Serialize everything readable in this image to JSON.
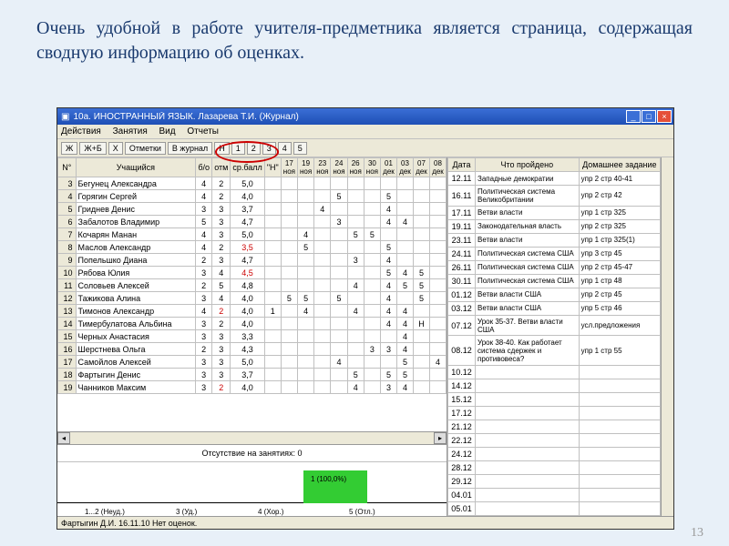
{
  "slide_title": "Очень удобной в работе учителя-предметника является страница, содержащая сводную информацию об оценках.",
  "page_number": "13",
  "window": {
    "title": "10а. ИНОСТРАННЫЙ ЯЗЫК. Лазарева Т.И. (Журнал)",
    "menu": [
      "Действия",
      "Занятия",
      "Вид",
      "Отчеты"
    ],
    "toolbar_buttons": [
      "Ж",
      "Ж+Б",
      "X",
      "Отметки",
      "В журнал",
      "Н",
      "1",
      "2",
      "3",
      "4",
      "5"
    ]
  },
  "grid": {
    "headers": [
      "N°",
      "Учащийся",
      "б/о",
      "отм",
      "ср.балл",
      "\"Н\"",
      "17 ноя",
      "19 ноя",
      "23 ноя",
      "24 ноя",
      "26 ноя",
      "30 ноя",
      "01 дек",
      "03 дек",
      "07 дек",
      "08 дек"
    ],
    "rows": [
      {
        "n": "3",
        "name": "Бегунец Александра",
        "bo": "4",
        "otm": "2",
        "avg": "5,0",
        "h": "",
        "m": [
          "",
          "",
          "",
          "",
          "",
          "",
          "",
          "",
          "",
          ""
        ]
      },
      {
        "n": "4",
        "name": "Горягин Сергей",
        "bo": "4",
        "otm": "2",
        "avg": "4,0",
        "h": "",
        "m": [
          "",
          "",
          "",
          "5",
          "",
          "",
          "5",
          "",
          "",
          ""
        ]
      },
      {
        "n": "5",
        "name": "Гриднев Денис",
        "bo": "3",
        "otm": "3",
        "avg": "3,7",
        "h": "",
        "m": [
          "",
          "",
          "4",
          "",
          "",
          "",
          "4",
          "",
          "",
          ""
        ]
      },
      {
        "n": "6",
        "name": "Забалотов Владимир",
        "bo": "5",
        "otm": "3",
        "avg": "4,7",
        "h": "",
        "m": [
          "",
          "",
          "",
          "3",
          "",
          "",
          "4",
          "4",
          "",
          ""
        ]
      },
      {
        "n": "7",
        "name": "Кочарян Манан",
        "bo": "4",
        "otm": "3",
        "avg": "5,0",
        "h": "",
        "m": [
          "",
          "4",
          "",
          "",
          "5",
          "5",
          "",
          "",
          "",
          ""
        ]
      },
      {
        "n": "8",
        "name": "Маслов Александр",
        "bo": "4",
        "otm": "2",
        "avg": "3,5",
        "h": "",
        "m": [
          "",
          "5",
          "",
          "",
          "",
          "",
          "5",
          "",
          "",
          ""
        ],
        "avg_red": true
      },
      {
        "n": "9",
        "name": "Попельшко Диана",
        "bo": "2",
        "otm": "3",
        "avg": "4,7",
        "h": "",
        "m": [
          "",
          "",
          "",
          "",
          "3",
          "",
          "4",
          "",
          "",
          ""
        ]
      },
      {
        "n": "10",
        "name": "Рябова Юлия",
        "bo": "3",
        "otm": "4",
        "avg": "4,5",
        "h": "",
        "m": [
          "",
          "",
          "",
          "",
          "",
          "",
          "5",
          "4",
          "5",
          ""
        ],
        "avg_red": true
      },
      {
        "n": "11",
        "name": "Соловьев Алексей",
        "bo": "2",
        "otm": "5",
        "avg": "4,8",
        "h": "",
        "m": [
          "",
          "",
          "",
          "",
          "4",
          "",
          "4",
          "5",
          "5",
          ""
        ]
      },
      {
        "n": "12",
        "name": "Тажикова Алина",
        "bo": "3",
        "otm": "4",
        "avg": "4,0",
        "h": "",
        "m": [
          "5",
          "5",
          "",
          "5",
          "",
          "",
          "4",
          "",
          "5",
          ""
        ]
      },
      {
        "n": "13",
        "name": "Тимонов Александр",
        "bo": "4",
        "otm": "2",
        "avg": "4,0",
        "h": "1",
        "m": [
          "",
          "4",
          "",
          "",
          "4",
          "",
          "4",
          "4",
          "",
          ""
        ],
        "otm_red": true
      },
      {
        "n": "14",
        "name": "Тимербулатова Альбина",
        "bo": "3",
        "otm": "2",
        "avg": "4,0",
        "h": "",
        "m": [
          "",
          "",
          "",
          "",
          "",
          "",
          "4",
          "4",
          "Н",
          ""
        ]
      },
      {
        "n": "15",
        "name": "Черных Анастасия",
        "bo": "3",
        "otm": "3",
        "avg": "3,3",
        "h": "",
        "m": [
          "",
          "",
          "",
          "",
          "",
          "",
          "",
          "4",
          "",
          ""
        ]
      },
      {
        "n": "16",
        "name": "Шерстнева Ольга",
        "bo": "2",
        "otm": "3",
        "avg": "4,3",
        "h": "",
        "m": [
          "",
          "",
          "",
          "",
          "",
          "3",
          "3",
          "4",
          "",
          ""
        ]
      },
      {
        "n": "17",
        "name": "Самойлов Алексей",
        "bo": "3",
        "otm": "3",
        "avg": "5,0",
        "h": "",
        "m": [
          "",
          "",
          "",
          "4",
          "",
          "",
          "",
          "5",
          "",
          "4"
        ]
      },
      {
        "n": "18",
        "name": "Фартыгин Денис",
        "bo": "3",
        "otm": "3",
        "avg": "3,7",
        "h": "",
        "m": [
          "",
          "",
          "",
          "",
          "5",
          "",
          "5",
          "5",
          "",
          ""
        ]
      },
      {
        "n": "19",
        "name": "Чанников Максим",
        "bo": "3",
        "otm": "2",
        "avg": "4,0",
        "h": "",
        "m": [
          "",
          "",
          "",
          "",
          "4",
          "",
          "3",
          "4",
          "",
          ""
        ],
        "otm_red": true
      }
    ]
  },
  "absence_text": "Отсутствие на занятиях: 0",
  "chart_data": {
    "type": "bar",
    "categories": [
      "1...2 (Неуд.)",
      "3 (Уд.)",
      "4 (Хор.)",
      "5 (Отл.)"
    ],
    "values": [
      0,
      0,
      0,
      1
    ],
    "labels": [
      "",
      "",
      "",
      "1 (100,0%)"
    ],
    "title": "",
    "xlabel": "",
    "ylabel": "",
    "ylim": [
      0,
      1
    ]
  },
  "right": {
    "headers": [
      "Дата",
      "Что пройдено",
      "Домашнее задание"
    ],
    "rows": [
      {
        "d": "12.11",
        "t": "Западные демократии",
        "h": "упр 2 стр 40-41"
      },
      {
        "d": "16.11",
        "t": "Политическая система Великобритании",
        "h": "упр 2 стр 42"
      },
      {
        "d": "17.11",
        "t": "Ветви власти",
        "h": "упр 1 стр 325"
      },
      {
        "d": "19.11",
        "t": "Законодательная власть",
        "h": "упр 2 стр 325"
      },
      {
        "d": "23.11",
        "t": "Ветви власти",
        "h": "упр 1 стр 325(1)"
      },
      {
        "d": "24.11",
        "t": "Политическая система США",
        "h": "упр 3 стр 45"
      },
      {
        "d": "26.11",
        "t": "Политическая система США",
        "h": "упр 2 стр 45-47"
      },
      {
        "d": "30.11",
        "t": "Политическая система США",
        "h": "упр 1 стр 48"
      },
      {
        "d": "01.12",
        "t": "Ветви власти США",
        "h": "упр 2 стр 45"
      },
      {
        "d": "03.12",
        "t": "Ветви власти США",
        "h": "упр 5 стр 46"
      },
      {
        "d": "07.12",
        "t": "Урок 35-37. Ветви власти США",
        "h": "усл.предложения"
      },
      {
        "d": "08.12",
        "t": "Урок 38-40. Как работает система сдержек и противовеса?",
        "h": "упр 1 стр 55"
      },
      {
        "d": "10.12",
        "t": "",
        "h": ""
      },
      {
        "d": "14.12",
        "t": "",
        "h": ""
      },
      {
        "d": "15.12",
        "t": "",
        "h": ""
      },
      {
        "d": "17.12",
        "t": "",
        "h": ""
      },
      {
        "d": "21.12",
        "t": "",
        "h": ""
      },
      {
        "d": "22.12",
        "t": "",
        "h": ""
      },
      {
        "d": "24.12",
        "t": "",
        "h": ""
      },
      {
        "d": "28.12",
        "t": "",
        "h": ""
      },
      {
        "d": "29.12",
        "t": "",
        "h": ""
      },
      {
        "d": "04.01",
        "t": "",
        "h": ""
      },
      {
        "d": "05.01",
        "t": "",
        "h": ""
      }
    ]
  },
  "statusbar": "Фартыгин Д.И. 16.11.10 Нет оценок."
}
